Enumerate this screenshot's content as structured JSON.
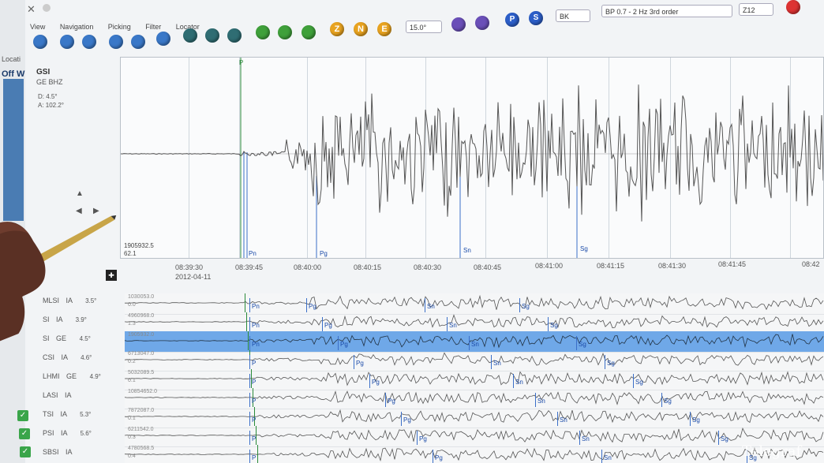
{
  "toolbar": {
    "menus": [
      "View",
      "Navigation",
      "Picking",
      "Filter",
      "Locator"
    ],
    "component_buttons": [
      "Z",
      "N",
      "E"
    ],
    "pick_buttons": [
      "P",
      "S"
    ],
    "window_value": "15.0°",
    "network_select": "BK",
    "filter_select": "BP 0.7 - 2 Hz 3rd order",
    "component_select": "Z12",
    "left_label": "Off W",
    "left_label2": "Locati"
  },
  "main_trace": {
    "station": "GSI",
    "channel": "GE BHZ",
    "distance": "D: 4.5°",
    "azimuth": "A: 102.2°",
    "amplitude": "1905932.5",
    "amp2": "62.1",
    "picks": [
      "P",
      "Pn",
      "Pg",
      "Sn",
      "Sg"
    ],
    "time_ticks": [
      "08:39:30",
      "08:39:45",
      "08:40:00",
      "08:40:15",
      "08:40:30",
      "08:40:45",
      "08:41:00",
      "08:41:15",
      "08:41:30",
      "08:41:45",
      "08:42"
    ],
    "date": "2012-04-11"
  },
  "stations": [
    {
      "code": "MLSI",
      "net": "IA",
      "dist": "3.5°",
      "amp": "1030053.0",
      "amp2": "0.0",
      "p1": "Pn",
      "p2": "Pg",
      "p3": "Sn",
      "p4": "Sg"
    },
    {
      "code": "SI",
      "net": "IA",
      "dist": "3.9°",
      "amp": "4960968.0",
      "amp2": "1.3",
      "p1": "Pn",
      "p2": "Pg",
      "p3": "Sn",
      "p4": "Sg"
    },
    {
      "code": "SI",
      "net": "GE",
      "dist": "4.5°",
      "amp": "1905932.0",
      "amp2": "",
      "p1": "Pn",
      "p2": "Pg",
      "p3": "Sn",
      "p4": "Sg"
    },
    {
      "code": "CSI",
      "net": "IA",
      "dist": "4.6°",
      "amp": "6713047.0",
      "amp2": "0.2",
      "p1": "P",
      "p2": "Pg",
      "p3": "Sn",
      "p4": "Sg"
    },
    {
      "code": "LHMI",
      "net": "GE",
      "dist": "4.9°",
      "amp": "5032089.5",
      "amp2": "0.1",
      "p1": "P",
      "p2": "Pg",
      "p3": "Sn",
      "p4": "Sg"
    },
    {
      "code": "LASI",
      "net": "IA",
      "dist": "",
      "amp": "10854652.0",
      "amp2": "",
      "p1": "P",
      "p2": "Pg",
      "p3": "Sn",
      "p4": "Sg"
    },
    {
      "code": "TSI",
      "net": "IA",
      "dist": "5.3°",
      "amp": "7872087.0",
      "amp2": "0.1",
      "p1": "P",
      "p2": "Pg",
      "p3": "Sn",
      "p4": "Sg"
    },
    {
      "code": "PSI",
      "net": "IA",
      "dist": "5.6°",
      "amp": "6211542.0",
      "amp2": "0.3",
      "p1": "P",
      "p2": "Pg",
      "p3": "Sn",
      "p4": "Sg"
    },
    {
      "code": "SBSI",
      "net": "IA",
      "dist": "",
      "amp": "4780568.5",
      "amp2": "0.4",
      "p1": "P",
      "p2": "Pg",
      "p3": "Sn",
      "p4": "Sg"
    }
  ],
  "watermark": "Telegraf"
}
